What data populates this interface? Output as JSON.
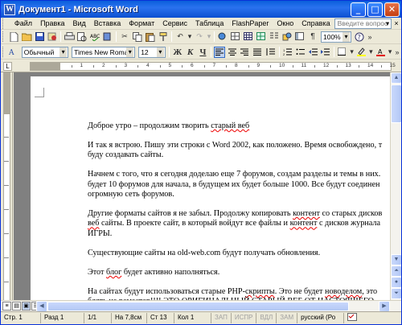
{
  "window": {
    "title": "Документ1 - Microsoft Word",
    "minimize": "_",
    "maximize": "□",
    "close": "✕"
  },
  "menu": {
    "items": [
      "Файл",
      "Правка",
      "Вид",
      "Вставка",
      "Формат",
      "Сервис",
      "Таблица",
      "FlashPaper",
      "Окно",
      "Справка"
    ],
    "help_placeholder": "Введите вопрос",
    "close_doc": "×"
  },
  "toolbar": {
    "zoom": "100%",
    "style": "Обычный",
    "font": "Times New Roman",
    "size": "12",
    "bold": "Ж",
    "italic": "К",
    "underline": "Ч"
  },
  "ruler": {
    "numbers": [
      "1",
      "2",
      "3",
      "4",
      "5",
      "6",
      "7",
      "8",
      "9",
      "10",
      "11",
      "12",
      "13",
      "14",
      "15"
    ]
  },
  "document": {
    "paragraphs": [
      "Доброе утро – продолжим творить старый веб",
      "И так я встрою. Пишу эти строки с Word 2002, как положено. Время освобождено, т",
      "буду создавать сайты.",
      "Начнем с того, что я сегодня доделаю еще 7 форумов, создам разделы и темы в них.",
      "будет 10 форумов для начала, в будущем их будет больше 1000. Все будут соединен",
      "огромную сеть форумов.",
      "Другие форматы сайтов я не забыл. Продолжу копировать контент со старых дисков",
      "веб сайты. В проекте сайт, в который войдут все файлы и контент с дисков журнала",
      "ИГРЫ.",
      "Существующие сайты на old-web.com будут получать обновления.",
      "Этот блог будет активно наполняться.",
      "На сайтах будут использоваться старые PHP-скрипты. Это не будет новоделом, это",
      "блять не ремастер!!!! ЭТО ОРИГИНАЛЬНЫЙ СТАРЫЙ ВЕБ ОТ НАСТОЯЩЕГО"
    ]
  },
  "status": {
    "page": "Стр. 1",
    "section": "Разд 1",
    "pages": "1/1",
    "pos": "На 7,8см",
    "line": "Ст 13",
    "col": "Кол 1",
    "rec": "ЗАП",
    "trk": "ИСПР",
    "ext": "ВДЛ",
    "ovr": "ЗАМ",
    "lang": "русский (Ро"
  }
}
